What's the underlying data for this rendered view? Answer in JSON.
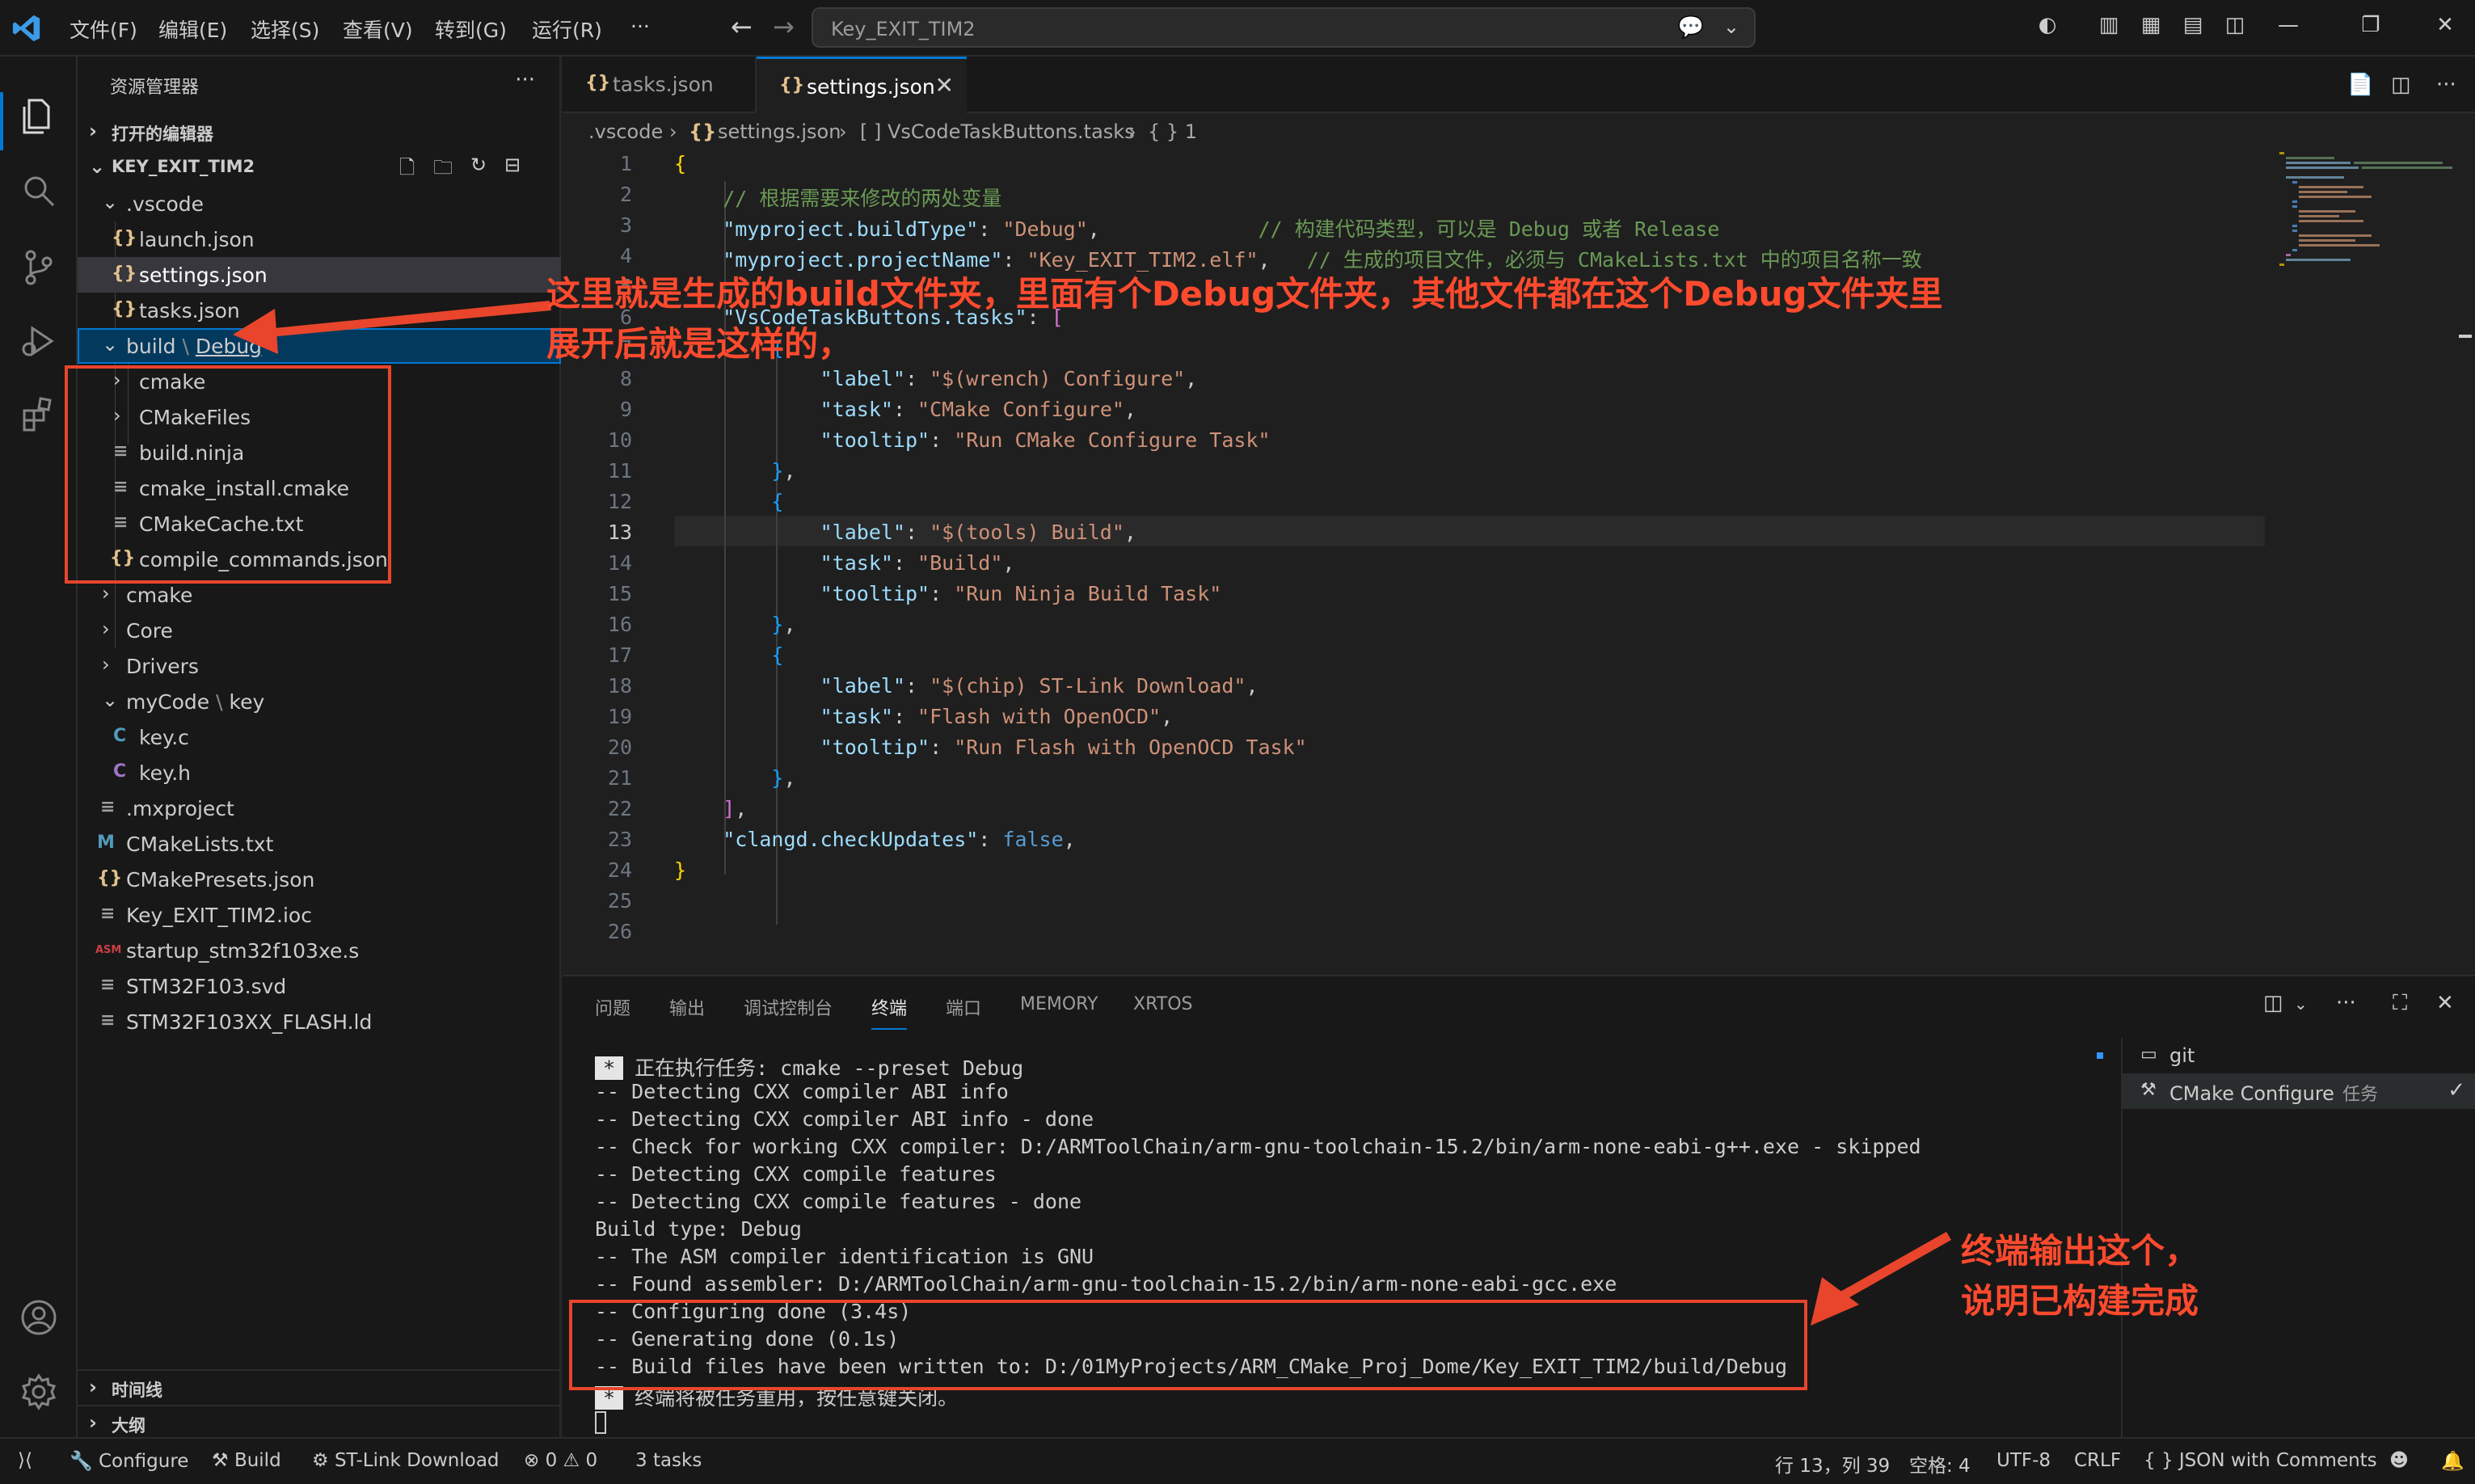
{
  "titlebar": {
    "menu": [
      "文件(F)",
      "编辑(E)",
      "选择(S)",
      "查看(V)",
      "转到(G)",
      "运行(R)",
      "···"
    ],
    "search_text": "Key_EXIT_TIM2"
  },
  "sidebar": {
    "title": "资源管理器",
    "open_editors": "打开的编辑器",
    "project": "KEY_EXIT_TIM2",
    "timeline": "时间线",
    "outline": "大纲",
    "tree": {
      "vscode": ".vscode",
      "launch": "launch.json",
      "settings": "settings.json",
      "tasks": "tasks.json",
      "build_a": "build",
      "build_sep": "\\",
      "build_b": "Debug",
      "cmake_sub": "cmake",
      "cmakefiles": "CMakeFiles",
      "build_ninja": "build.ninja",
      "cmake_install": "cmake_install.cmake",
      "cmakecache": "CMakeCache.txt",
      "compile_commands": "compile_commands.json",
      "cmake": "cmake",
      "core": "Core",
      "drivers": "Drivers",
      "mycode_a": "myCode",
      "mycode_sep": "\\",
      "mycode_b": "key",
      "key_c": "key.c",
      "key_h": "key.h",
      "mxproject": ".mxproject",
      "cmakelists": "CMakeLists.txt",
      "cmakepresets": "CMakePresets.json",
      "ioc": "Key_EXIT_TIM2.ioc",
      "startup": "startup_stm32f103xe.s",
      "svd": "STM32F103.svd",
      "ld": "STM32F103XX_FLASH.ld"
    }
  },
  "tabs": {
    "t1": "tasks.json",
    "t2": "settings.json"
  },
  "breadcrumb": {
    "b1": ".vscode",
    "b2": "settings.json",
    "b3": "[ ] VsCodeTaskButtons.tasks",
    "b4": "{ } 1"
  },
  "editor": {
    "line_numbers": [
      "1",
      "2",
      "3",
      "4",
      "5",
      "6",
      "7",
      "8",
      "9",
      "10",
      "11",
      "12",
      "13",
      "14",
      "15",
      "16",
      "17",
      "18",
      "19",
      "20",
      "21",
      "22",
      "23",
      "24",
      "25",
      "26"
    ],
    "current_line": 13,
    "code": {
      "l2_comment": "// 根据需要来修改的两处变量",
      "l3_key": "\"myproject.buildType\"",
      "l3_val": "\"Debug\"",
      "l3_comment": "// 构建代码类型，可以是 Debug 或者 Release",
      "l4_key": "\"myproject.projectName\"",
      "l4_val": "\"Key_EXIT_TIM2.elf\"",
      "l4_comment": "// 生成的项目文件，必须与 CMakeLists.txt 中的项目名称一致",
      "l6_key": "\"VsCodeTaskButtons.tasks\"",
      "label": "\"label\"",
      "task": "\"task\"",
      "tooltip": "\"tooltip\"",
      "l8_val": "\"$(wrench) Configure\"",
      "l9_val": "\"CMake Configure\"",
      "l10_val": "\"Run CMake Configure Task\"",
      "l13_val": "\"$(tools) Build\"",
      "l14_val": "\"Build\"",
      "l15_val": "\"Run Ninja Build Task\"",
      "l18_val": "\"$(chip) ST-Link Download\"",
      "l19_val": "\"Flash with OpenOCD\"",
      "l20_val": "\"Run Flash with OpenOCD Task\"",
      "l23_key": "\"clangd.checkUpdates\"",
      "l23_val": "false"
    }
  },
  "panel": {
    "tabs": [
      "问题",
      "输出",
      "调试控制台",
      "终端",
      "端口",
      "MEMORY",
      "XRTOS"
    ],
    "active_tab": "终端",
    "terminal": {
      "badge": "*",
      "task_line": "正在执行任务: cmake --preset Debug",
      "lines": [
        "-- Detecting CXX compiler ABI info",
        "-- Detecting CXX compiler ABI info - done",
        "-- Check for working CXX compiler: D:/ARMToolChain/arm-gnu-toolchain-15.2/bin/arm-none-eabi-g++.exe - skipped",
        "-- Detecting CXX compile features",
        "-- Detecting CXX compile features - done",
        "Build type: Debug",
        "-- The ASM compiler identification is GNU",
        "-- Found assembler: D:/ARMToolChain/arm-gnu-toolchain-15.2/bin/arm-none-eabi-gcc.exe",
        "-- Configuring done (3.4s)",
        "-- Generating done (0.1s)",
        "-- Build files have been written to: D:/01MyProjects/ARM_CMake_Proj_Dome/Key_EXIT_TIM2/build/Debug"
      ],
      "reuse_line": "终端将被任务重用，按任意键关闭。"
    },
    "terminal_list": {
      "git": "git",
      "cmake": "CMake Configure",
      "cmake_sub": "任务"
    }
  },
  "statusbar": {
    "configure": "Configure",
    "build": "Build",
    "stlink": "ST-Link Download",
    "errors": "0",
    "warnings": "0",
    "tasks": "3 tasks",
    "position": "行 13，列 39",
    "spaces": "空格: 4",
    "encoding": "UTF-8",
    "eol": "CRLF",
    "language": "JSON with Comments"
  },
  "annotations": {
    "a1_line1": "这里就是生成的build文件夹，里面有个Debug文件夹，其他文件都在这个Debug文件夹里",
    "a1_line2": "展开后就是这样的，",
    "a2_line1": "终端输出这个，",
    "a2_line2": "说明已构建完成"
  },
  "colors": {
    "accent": "#0078d4",
    "annotation": "#e8452c",
    "json_icon": "#e2c08d"
  }
}
